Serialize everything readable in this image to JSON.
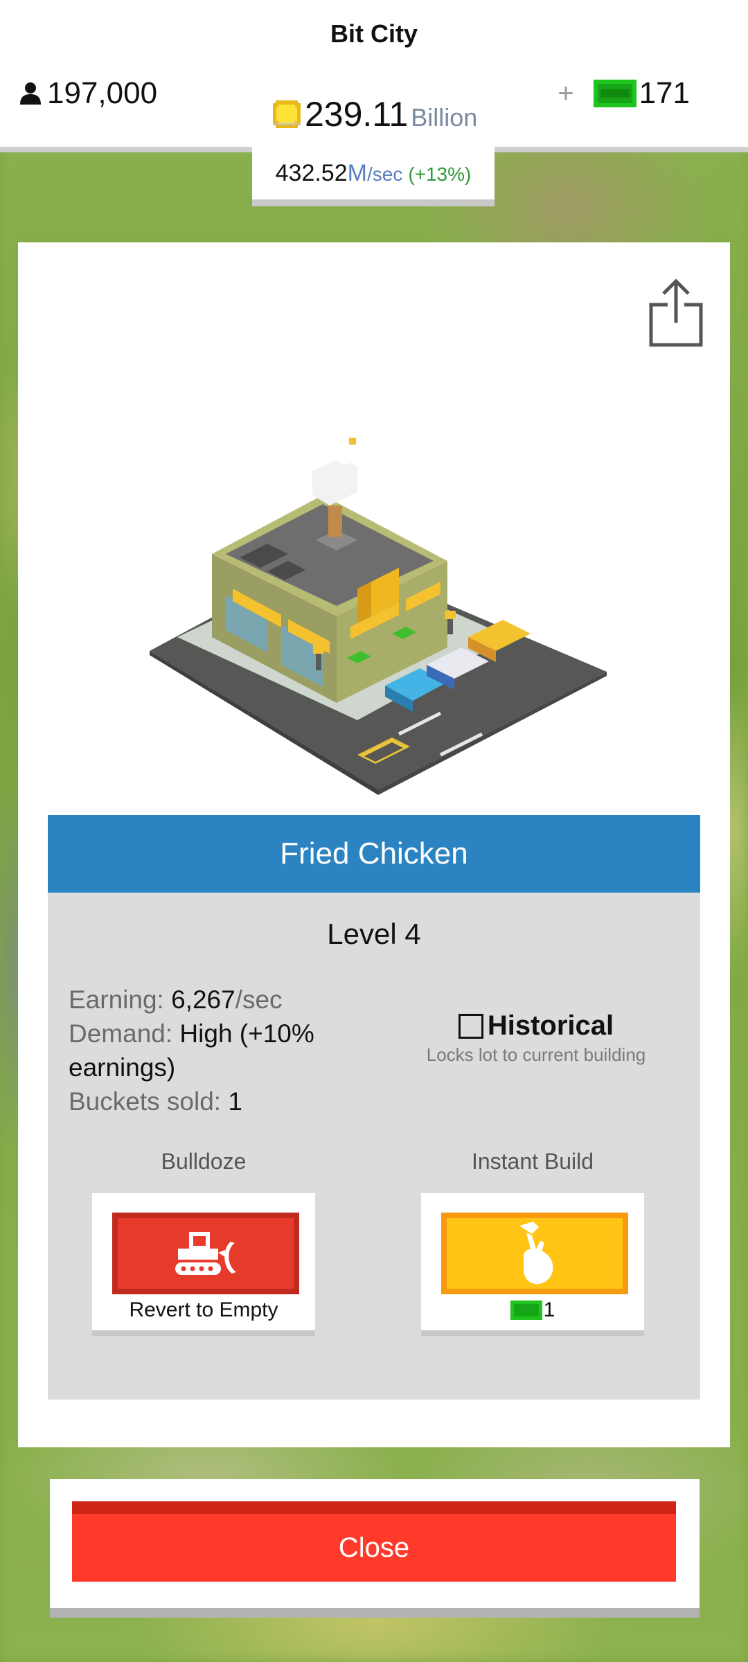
{
  "header": {
    "app_title": "Bit City",
    "population": "197,000",
    "coins_value": "239.11",
    "coins_unit": "Billion",
    "plus_label": "+",
    "cash_value": "171",
    "income_value": "432.52",
    "income_unit": "M",
    "income_per": "/sec",
    "income_boost": "(+13%)"
  },
  "building": {
    "name": "Fried Chicken",
    "level": "Level 4",
    "stats": {
      "earning_label": "Earning:",
      "earning_value": "6,267",
      "earning_unit": "/sec",
      "demand_label": "Demand:",
      "demand_value": "High (+10% earnings)",
      "sold_label": "Buckets sold:",
      "sold_value": "1"
    },
    "historical": {
      "label": "Historical",
      "description": "Locks lot to current building",
      "checked": false
    },
    "actions": {
      "bulldoze_label": "Bulldoze",
      "bulldoze_caption": "Revert to Empty",
      "instant_label": "Instant Build",
      "instant_cost": "1"
    }
  },
  "close_label": "Close",
  "icons": {
    "population": "person-icon",
    "coins": "coin-icon",
    "cash": "cash-icon",
    "share": "share-icon",
    "bulldoze": "bulldozer-icon",
    "instant": "hammer-hand-icon"
  },
  "colors": {
    "title_bar": "#2b84c1",
    "bulldoze": "#e63a2b",
    "instant": "#ffc414",
    "close": "#ff3a2a",
    "cash": "#1fc41f",
    "boost": "#2e9a3a"
  }
}
